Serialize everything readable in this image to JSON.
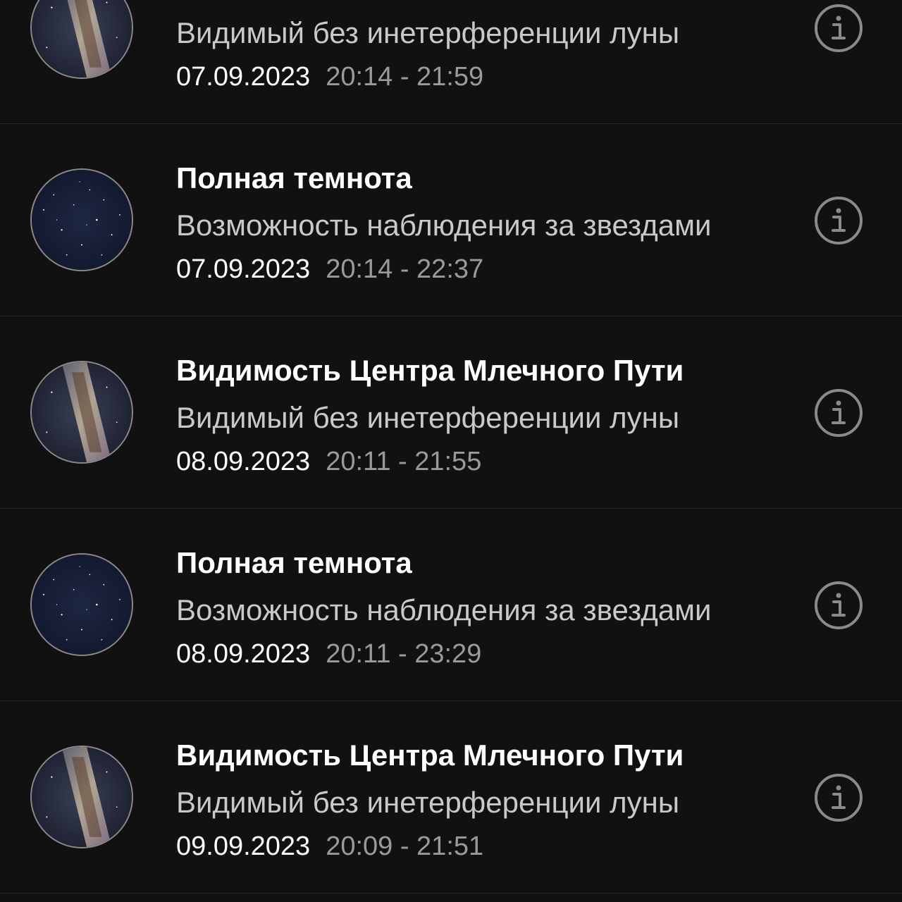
{
  "events": [
    {
      "thumb": "milky-way",
      "title": "",
      "subtitle": "Видимый без инетерференции луны",
      "date": "07.09.2023",
      "time": "20:14 - 21:59"
    },
    {
      "thumb": "starfield",
      "title": "Полная темнота",
      "subtitle": "Возможность наблюдения за звездами",
      "date": "07.09.2023",
      "time": "20:14 - 22:37"
    },
    {
      "thumb": "milky-way",
      "title": "Видимость Центра Млечного Пути",
      "subtitle": "Видимый без инетерференции луны",
      "date": "08.09.2023",
      "time": "20:11 - 21:55"
    },
    {
      "thumb": "starfield",
      "title": "Полная темнота",
      "subtitle": "Возможность наблюдения за звездами",
      "date": "08.09.2023",
      "time": "20:11 - 23:29"
    },
    {
      "thumb": "milky-way",
      "title": "Видимость Центра Млечного Пути",
      "subtitle": "Видимый без инетерференции луны",
      "date": "09.09.2023",
      "time": "20:09 - 21:51"
    }
  ],
  "icons": {
    "info": "info-icon"
  },
  "colors": {
    "background": "#111111",
    "divider": "#262626",
    "title": "#ffffff",
    "subtitle": "#c9c9c9",
    "time": "#9a9a9a",
    "icon": "#8a8a8a"
  }
}
